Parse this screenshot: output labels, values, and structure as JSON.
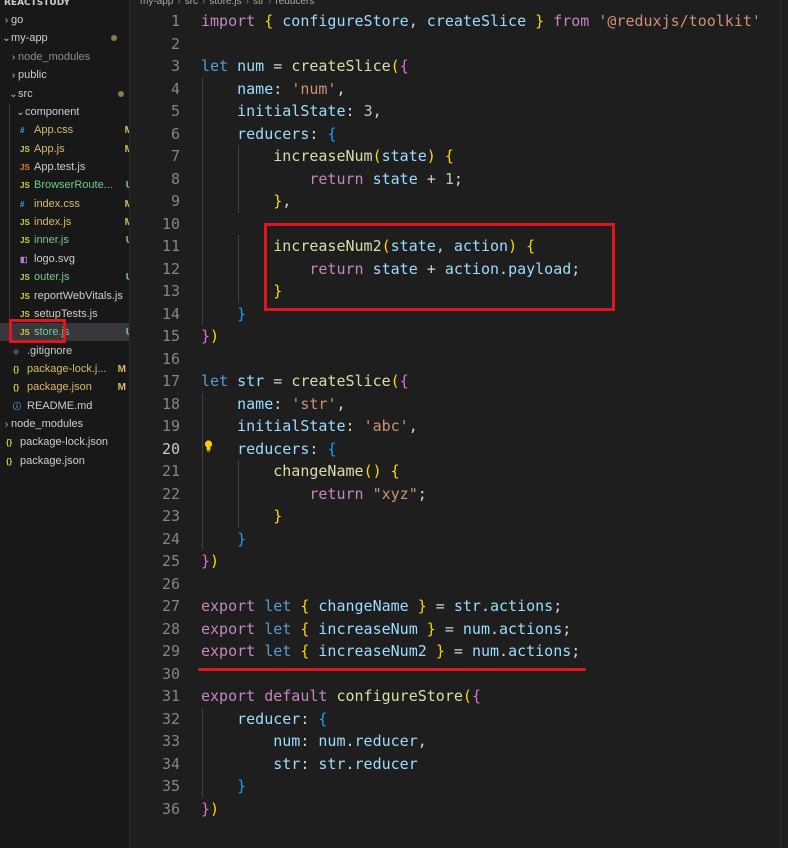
{
  "explorer": {
    "title": "REACTSTUDY",
    "items": [
      {
        "label": "go",
        "chev": "›",
        "indent": 0,
        "icon": "",
        "icon_name": "",
        "icon_color": "",
        "badge": "",
        "badge_color": "",
        "dot": false,
        "name_color": "#cccccc"
      },
      {
        "label": "my-app",
        "chev": "⌄",
        "indent": 0,
        "icon": "",
        "icon_name": "",
        "icon_color": "",
        "badge": "",
        "badge_color": "",
        "dot": true,
        "name_color": "#cccccc"
      },
      {
        "label": "node_modules",
        "chev": "›",
        "indent": 1,
        "icon": "",
        "icon_name": "",
        "icon_color": "",
        "badge": "",
        "badge_color": "",
        "dot": false,
        "name_color": "#8c8c8c"
      },
      {
        "label": "public",
        "chev": "›",
        "indent": 1,
        "icon": "",
        "icon_name": "",
        "icon_color": "",
        "badge": "",
        "badge_color": "",
        "dot": false,
        "name_color": "#cccccc"
      },
      {
        "label": "src",
        "chev": "⌄",
        "indent": 1,
        "icon": "",
        "icon_name": "",
        "icon_color": "",
        "badge": "",
        "badge_color": "",
        "dot": true,
        "name_color": "#cccccc"
      },
      {
        "label": "component",
        "chev": "⌄",
        "indent": 2,
        "icon": "",
        "icon_name": "",
        "icon_color": "",
        "badge": "",
        "badge_color": "",
        "dot": false,
        "name_color": "#cccccc"
      },
      {
        "label": "App.css",
        "chev": "",
        "indent": 2,
        "icon": "#",
        "icon_name": "css-file-icon",
        "icon_color": "#42a5f5",
        "badge": "M",
        "badge_color": "#d9b96a",
        "dot": false,
        "name_color": "#d9b96a"
      },
      {
        "label": "App.js",
        "chev": "",
        "indent": 2,
        "icon": "JS",
        "icon_name": "js-file-icon",
        "icon_color": "#cbcb41",
        "badge": "M",
        "badge_color": "#d9b96a",
        "dot": false,
        "name_color": "#d9b96a"
      },
      {
        "label": "App.test.js",
        "chev": "",
        "indent": 2,
        "icon": "JS",
        "icon_name": "test-file-icon",
        "icon_color": "#e37933",
        "badge": "",
        "badge_color": "",
        "dot": false,
        "name_color": "#cccccc"
      },
      {
        "label": "BrowserRoute...",
        "chev": "",
        "indent": 2,
        "icon": "JS",
        "icon_name": "js-file-icon",
        "icon_color": "#cbcb41",
        "badge": "U",
        "badge_color": "#73c991",
        "dot": false,
        "name_color": "#73c991"
      },
      {
        "label": "index.css",
        "chev": "",
        "indent": 2,
        "icon": "#",
        "icon_name": "css-file-icon",
        "icon_color": "#42a5f5",
        "badge": "M",
        "badge_color": "#d9b96a",
        "dot": false,
        "name_color": "#d9b96a"
      },
      {
        "label": "index.js",
        "chev": "",
        "indent": 2,
        "icon": "JS",
        "icon_name": "js-file-icon",
        "icon_color": "#cbcb41",
        "badge": "M",
        "badge_color": "#d9b96a",
        "dot": false,
        "name_color": "#d9b96a"
      },
      {
        "label": "inner.js",
        "chev": "",
        "indent": 2,
        "icon": "JS",
        "icon_name": "js-file-icon",
        "icon_color": "#cbcb41",
        "badge": "U",
        "badge_color": "#73c991",
        "dot": false,
        "name_color": "#73c991"
      },
      {
        "label": "logo.svg",
        "chev": "",
        "indent": 2,
        "icon": "◧",
        "icon_name": "svg-file-icon",
        "icon_color": "#b07cd8",
        "badge": "",
        "badge_color": "",
        "dot": false,
        "name_color": "#cccccc"
      },
      {
        "label": "outer.js",
        "chev": "",
        "indent": 2,
        "icon": "JS",
        "icon_name": "js-file-icon",
        "icon_color": "#cbcb41",
        "badge": "U",
        "badge_color": "#73c991",
        "dot": false,
        "name_color": "#73c991"
      },
      {
        "label": "reportWebVitals.js",
        "chev": "",
        "indent": 2,
        "icon": "JS",
        "icon_name": "js-file-icon",
        "icon_color": "#cbcb41",
        "badge": "",
        "badge_color": "",
        "dot": false,
        "name_color": "#cccccc"
      },
      {
        "label": "setupTests.js",
        "chev": "",
        "indent": 2,
        "icon": "JS",
        "icon_name": "js-file-icon",
        "icon_color": "#cbcb41",
        "badge": "",
        "badge_color": "",
        "dot": false,
        "name_color": "#cccccc"
      },
      {
        "label": "store.js",
        "chev": "",
        "indent": 2,
        "icon": "JS",
        "icon_name": "js-file-icon",
        "icon_color": "#cbcb41",
        "badge": "U",
        "badge_color": "#73c991",
        "dot": false,
        "name_color": "#73c991",
        "active": true
      },
      {
        "label": ".gitignore",
        "chev": "",
        "indent": 1,
        "icon": "◆",
        "icon_name": "git-file-icon",
        "icon_color": "#41535b",
        "badge": "",
        "badge_color": "",
        "dot": false,
        "name_color": "#cccccc"
      },
      {
        "label": "package-lock.j...",
        "chev": "",
        "indent": 1,
        "icon": "{}",
        "icon_name": "json-file-icon",
        "icon_color": "#cbcb41",
        "badge": "M",
        "badge_color": "#d9b96a",
        "dot": false,
        "name_color": "#d9b96a"
      },
      {
        "label": "package.json",
        "chev": "",
        "indent": 1,
        "icon": "{}",
        "icon_name": "json-file-icon",
        "icon_color": "#cbcb41",
        "badge": "M",
        "badge_color": "#d9b96a",
        "dot": false,
        "name_color": "#d9b96a"
      },
      {
        "label": "README.md",
        "chev": "",
        "indent": 1,
        "icon": "ⓘ",
        "icon_name": "info-file-icon",
        "icon_color": "#42a5f5",
        "badge": "",
        "badge_color": "",
        "dot": false,
        "name_color": "#cccccc"
      },
      {
        "label": "node_modules",
        "chev": "›",
        "indent": 0,
        "icon": "",
        "icon_name": "",
        "icon_color": "",
        "badge": "",
        "badge_color": "",
        "dot": false,
        "name_color": "#cccccc"
      },
      {
        "label": "package-lock.json",
        "chev": "",
        "indent": 0,
        "icon": "{}",
        "icon_name": "json-file-icon",
        "icon_color": "#cbcb41",
        "badge": "",
        "badge_color": "",
        "dot": false,
        "name_color": "#cccccc"
      },
      {
        "label": "package.json",
        "chev": "",
        "indent": 0,
        "icon": "{}",
        "icon_name": "json-file-icon",
        "icon_color": "#cbcb41",
        "badge": "",
        "badge_color": "",
        "dot": false,
        "name_color": "#cccccc"
      }
    ]
  },
  "breadcrumb": {
    "parts": [
      "my-app",
      "src",
      "store.js",
      "str",
      "reducers"
    ],
    "sep": "›"
  },
  "editor": {
    "current_line": 20,
    "lines": [
      [
        [
          "kw",
          "import"
        ],
        [
          "op",
          " "
        ],
        [
          "b1",
          "{"
        ],
        [
          "op",
          " "
        ],
        [
          "var",
          "configureStore"
        ],
        [
          "op",
          ", "
        ],
        [
          "var",
          "createSlice"
        ],
        [
          "op",
          " "
        ],
        [
          "b1",
          "}"
        ],
        [
          "op",
          " "
        ],
        [
          "kw",
          "from"
        ],
        [
          "op",
          " "
        ],
        [
          "str",
          "'@reduxjs/toolkit'"
        ]
      ],
      [],
      [
        [
          "kw2",
          "let"
        ],
        [
          "op",
          " "
        ],
        [
          "var",
          "num"
        ],
        [
          "op",
          " = "
        ],
        [
          "fn",
          "createSlice"
        ],
        [
          "b1",
          "("
        ],
        [
          "b2",
          "{"
        ]
      ],
      [
        [
          "op",
          "    "
        ],
        [
          "var",
          "name"
        ],
        [
          "op",
          ": "
        ],
        [
          "str",
          "'num'"
        ],
        [
          "op",
          ","
        ]
      ],
      [
        [
          "op",
          "    "
        ],
        [
          "var",
          "initialState"
        ],
        [
          "op",
          ": "
        ],
        [
          "num",
          "3"
        ],
        [
          "op",
          ","
        ]
      ],
      [
        [
          "op",
          "    "
        ],
        [
          "var",
          "reducers"
        ],
        [
          "op",
          ": "
        ],
        [
          "b3",
          "{"
        ]
      ],
      [
        [
          "op",
          "        "
        ],
        [
          "fn",
          "increaseNum"
        ],
        [
          "b1",
          "("
        ],
        [
          "var",
          "state"
        ],
        [
          "b1",
          ")"
        ],
        [
          "op",
          " "
        ],
        [
          "b1",
          "{"
        ]
      ],
      [
        [
          "op",
          "            "
        ],
        [
          "kw",
          "return"
        ],
        [
          "op",
          " "
        ],
        [
          "var",
          "state"
        ],
        [
          "op",
          " + "
        ],
        [
          "num",
          "1"
        ],
        [
          "op",
          ";"
        ]
      ],
      [
        [
          "op",
          "        "
        ],
        [
          "b1",
          "}"
        ],
        [
          "op",
          ","
        ]
      ],
      [],
      [
        [
          "op",
          "        "
        ],
        [
          "fn",
          "increaseNum2"
        ],
        [
          "b1",
          "("
        ],
        [
          "var",
          "state"
        ],
        [
          "op",
          ", "
        ],
        [
          "var",
          "action"
        ],
        [
          "b1",
          ")"
        ],
        [
          "op",
          " "
        ],
        [
          "b1",
          "{"
        ]
      ],
      [
        [
          "op",
          "            "
        ],
        [
          "kw",
          "return"
        ],
        [
          "op",
          " "
        ],
        [
          "var",
          "state"
        ],
        [
          "op",
          " + "
        ],
        [
          "var",
          "action"
        ],
        [
          "op",
          "."
        ],
        [
          "var",
          "payload"
        ],
        [
          "op",
          ";"
        ]
      ],
      [
        [
          "op",
          "        "
        ],
        [
          "b1",
          "}"
        ]
      ],
      [
        [
          "op",
          "    "
        ],
        [
          "b3",
          "}"
        ]
      ],
      [
        [
          "b2",
          "}"
        ],
        [
          "b1",
          ")"
        ]
      ],
      [],
      [
        [
          "kw2",
          "let"
        ],
        [
          "op",
          " "
        ],
        [
          "var",
          "str"
        ],
        [
          "op",
          " = "
        ],
        [
          "fn",
          "createSlice"
        ],
        [
          "b1",
          "("
        ],
        [
          "b2",
          "{"
        ]
      ],
      [
        [
          "op",
          "    "
        ],
        [
          "var",
          "name"
        ],
        [
          "op",
          ": "
        ],
        [
          "str",
          "'str'"
        ],
        [
          "op",
          ","
        ]
      ],
      [
        [
          "op",
          "    "
        ],
        [
          "var",
          "initialState"
        ],
        [
          "op",
          ": "
        ],
        [
          "str",
          "'abc'"
        ],
        [
          "op",
          ","
        ]
      ],
      [
        [
          "op",
          "    "
        ],
        [
          "var",
          "reducers"
        ],
        [
          "op",
          ": "
        ],
        [
          "b3",
          "{"
        ]
      ],
      [
        [
          "op",
          "        "
        ],
        [
          "fn",
          "changeName"
        ],
        [
          "b1",
          "()"
        ],
        [
          "op",
          " "
        ],
        [
          "b1",
          "{"
        ]
      ],
      [
        [
          "op",
          "            "
        ],
        [
          "kw",
          "return"
        ],
        [
          "op",
          " "
        ],
        [
          "str",
          "\"xyz\""
        ],
        [
          "op",
          ";"
        ]
      ],
      [
        [
          "op",
          "        "
        ],
        [
          "b1",
          "}"
        ]
      ],
      [
        [
          "op",
          "    "
        ],
        [
          "b3",
          "}"
        ]
      ],
      [
        [
          "b2",
          "}"
        ],
        [
          "b1",
          ")"
        ]
      ],
      [],
      [
        [
          "kw",
          "export"
        ],
        [
          "op",
          " "
        ],
        [
          "kw2",
          "let"
        ],
        [
          "op",
          " "
        ],
        [
          "b1",
          "{"
        ],
        [
          "op",
          " "
        ],
        [
          "var",
          "changeName"
        ],
        [
          "op",
          " "
        ],
        [
          "b1",
          "}"
        ],
        [
          "op",
          " = "
        ],
        [
          "var",
          "str"
        ],
        [
          "op",
          "."
        ],
        [
          "var",
          "actions"
        ],
        [
          "op",
          ";"
        ]
      ],
      [
        [
          "kw",
          "export"
        ],
        [
          "op",
          " "
        ],
        [
          "kw2",
          "let"
        ],
        [
          "op",
          " "
        ],
        [
          "b1",
          "{"
        ],
        [
          "op",
          " "
        ],
        [
          "var",
          "increaseNum"
        ],
        [
          "op",
          " "
        ],
        [
          "b1",
          "}"
        ],
        [
          "op",
          " = "
        ],
        [
          "var",
          "num"
        ],
        [
          "op",
          "."
        ],
        [
          "var",
          "actions"
        ],
        [
          "op",
          ";"
        ]
      ],
      [
        [
          "kw",
          "export"
        ],
        [
          "op",
          " "
        ],
        [
          "kw2",
          "let"
        ],
        [
          "op",
          " "
        ],
        [
          "b1",
          "{"
        ],
        [
          "op",
          " "
        ],
        [
          "var",
          "increaseNum2"
        ],
        [
          "op",
          " "
        ],
        [
          "b1",
          "}"
        ],
        [
          "op",
          " = "
        ],
        [
          "var",
          "num"
        ],
        [
          "op",
          "."
        ],
        [
          "var",
          "actions"
        ],
        [
          "op",
          ";"
        ]
      ],
      [],
      [
        [
          "kw",
          "export"
        ],
        [
          "op",
          " "
        ],
        [
          "kw",
          "default"
        ],
        [
          "op",
          " "
        ],
        [
          "fn",
          "configureStore"
        ],
        [
          "b1",
          "("
        ],
        [
          "b2",
          "{"
        ]
      ],
      [
        [
          "op",
          "    "
        ],
        [
          "var",
          "reducer"
        ],
        [
          "op",
          ": "
        ],
        [
          "b3",
          "{"
        ]
      ],
      [
        [
          "op",
          "        "
        ],
        [
          "var",
          "num"
        ],
        [
          "op",
          ": "
        ],
        [
          "var",
          "num"
        ],
        [
          "op",
          "."
        ],
        [
          "var",
          "reducer"
        ],
        [
          "op",
          ","
        ]
      ],
      [
        [
          "op",
          "        "
        ],
        [
          "var",
          "str"
        ],
        [
          "op",
          ": "
        ],
        [
          "var",
          "str"
        ],
        [
          "op",
          "."
        ],
        [
          "var",
          "reducer"
        ]
      ],
      [
        [
          "op",
          "    "
        ],
        [
          "b3",
          "}"
        ]
      ],
      [
        [
          "b2",
          "}"
        ],
        [
          "b1",
          ")"
        ]
      ]
    ]
  },
  "colors": {
    "highlight_box": "#e0161e",
    "modified": "#d9b96a",
    "untracked": "#73c991"
  }
}
